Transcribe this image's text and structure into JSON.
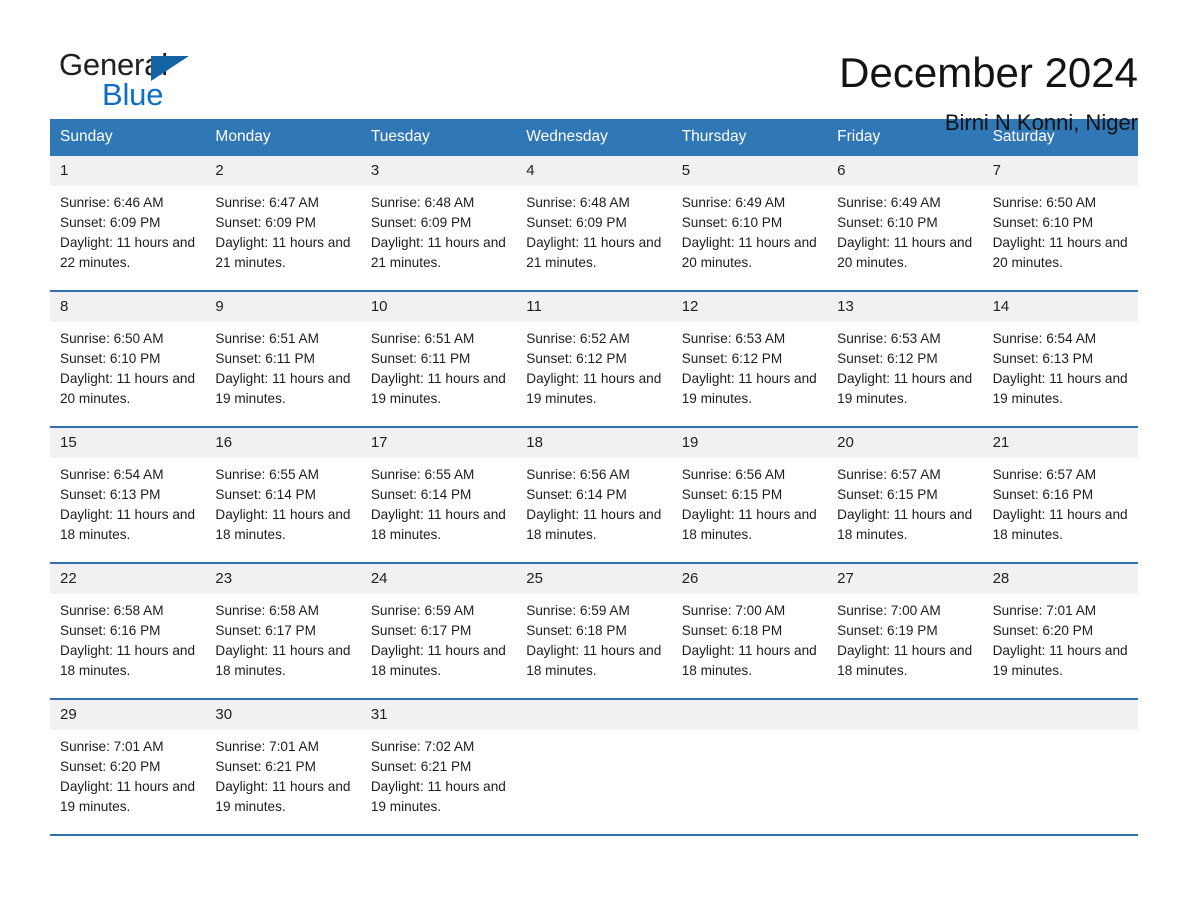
{
  "brand": {
    "name_part1": "General",
    "name_part2": "Blue"
  },
  "header": {
    "month_title": "December 2024",
    "location": "Birni N Konni, Niger"
  },
  "colors": {
    "header_blue": "#3077b5",
    "row_divider_blue": "#2e6fae",
    "date_band_gray": "#f1f1f1",
    "brand_blue": "#0d6fc4"
  },
  "calendar": {
    "weekdays": [
      "Sunday",
      "Monday",
      "Tuesday",
      "Wednesday",
      "Thursday",
      "Friday",
      "Saturday"
    ],
    "weeks": [
      {
        "days": [
          {
            "date": "1",
            "sunrise": "Sunrise: 6:46 AM",
            "sunset": "Sunset: 6:09 PM",
            "daylight": "Daylight: 11 hours and 22 minutes."
          },
          {
            "date": "2",
            "sunrise": "Sunrise: 6:47 AM",
            "sunset": "Sunset: 6:09 PM",
            "daylight": "Daylight: 11 hours and 21 minutes."
          },
          {
            "date": "3",
            "sunrise": "Sunrise: 6:48 AM",
            "sunset": "Sunset: 6:09 PM",
            "daylight": "Daylight: 11 hours and 21 minutes."
          },
          {
            "date": "4",
            "sunrise": "Sunrise: 6:48 AM",
            "sunset": "Sunset: 6:09 PM",
            "daylight": "Daylight: 11 hours and 21 minutes."
          },
          {
            "date": "5",
            "sunrise": "Sunrise: 6:49 AM",
            "sunset": "Sunset: 6:10 PM",
            "daylight": "Daylight: 11 hours and 20 minutes."
          },
          {
            "date": "6",
            "sunrise": "Sunrise: 6:49 AM",
            "sunset": "Sunset: 6:10 PM",
            "daylight": "Daylight: 11 hours and 20 minutes."
          },
          {
            "date": "7",
            "sunrise": "Sunrise: 6:50 AM",
            "sunset": "Sunset: 6:10 PM",
            "daylight": "Daylight: 11 hours and 20 minutes."
          }
        ]
      },
      {
        "days": [
          {
            "date": "8",
            "sunrise": "Sunrise: 6:50 AM",
            "sunset": "Sunset: 6:10 PM",
            "daylight": "Daylight: 11 hours and 20 minutes."
          },
          {
            "date": "9",
            "sunrise": "Sunrise: 6:51 AM",
            "sunset": "Sunset: 6:11 PM",
            "daylight": "Daylight: 11 hours and 19 minutes."
          },
          {
            "date": "10",
            "sunrise": "Sunrise: 6:51 AM",
            "sunset": "Sunset: 6:11 PM",
            "daylight": "Daylight: 11 hours and 19 minutes."
          },
          {
            "date": "11",
            "sunrise": "Sunrise: 6:52 AM",
            "sunset": "Sunset: 6:12 PM",
            "daylight": "Daylight: 11 hours and 19 minutes."
          },
          {
            "date": "12",
            "sunrise": "Sunrise: 6:53 AM",
            "sunset": "Sunset: 6:12 PM",
            "daylight": "Daylight: 11 hours and 19 minutes."
          },
          {
            "date": "13",
            "sunrise": "Sunrise: 6:53 AM",
            "sunset": "Sunset: 6:12 PM",
            "daylight": "Daylight: 11 hours and 19 minutes."
          },
          {
            "date": "14",
            "sunrise": "Sunrise: 6:54 AM",
            "sunset": "Sunset: 6:13 PM",
            "daylight": "Daylight: 11 hours and 19 minutes."
          }
        ]
      },
      {
        "days": [
          {
            "date": "15",
            "sunrise": "Sunrise: 6:54 AM",
            "sunset": "Sunset: 6:13 PM",
            "daylight": "Daylight: 11 hours and 18 minutes."
          },
          {
            "date": "16",
            "sunrise": "Sunrise: 6:55 AM",
            "sunset": "Sunset: 6:14 PM",
            "daylight": "Daylight: 11 hours and 18 minutes."
          },
          {
            "date": "17",
            "sunrise": "Sunrise: 6:55 AM",
            "sunset": "Sunset: 6:14 PM",
            "daylight": "Daylight: 11 hours and 18 minutes."
          },
          {
            "date": "18",
            "sunrise": "Sunrise: 6:56 AM",
            "sunset": "Sunset: 6:14 PM",
            "daylight": "Daylight: 11 hours and 18 minutes."
          },
          {
            "date": "19",
            "sunrise": "Sunrise: 6:56 AM",
            "sunset": "Sunset: 6:15 PM",
            "daylight": "Daylight: 11 hours and 18 minutes."
          },
          {
            "date": "20",
            "sunrise": "Sunrise: 6:57 AM",
            "sunset": "Sunset: 6:15 PM",
            "daylight": "Daylight: 11 hours and 18 minutes."
          },
          {
            "date": "21",
            "sunrise": "Sunrise: 6:57 AM",
            "sunset": "Sunset: 6:16 PM",
            "daylight": "Daylight: 11 hours and 18 minutes."
          }
        ]
      },
      {
        "days": [
          {
            "date": "22",
            "sunrise": "Sunrise: 6:58 AM",
            "sunset": "Sunset: 6:16 PM",
            "daylight": "Daylight: 11 hours and 18 minutes."
          },
          {
            "date": "23",
            "sunrise": "Sunrise: 6:58 AM",
            "sunset": "Sunset: 6:17 PM",
            "daylight": "Daylight: 11 hours and 18 minutes."
          },
          {
            "date": "24",
            "sunrise": "Sunrise: 6:59 AM",
            "sunset": "Sunset: 6:17 PM",
            "daylight": "Daylight: 11 hours and 18 minutes."
          },
          {
            "date": "25",
            "sunrise": "Sunrise: 6:59 AM",
            "sunset": "Sunset: 6:18 PM",
            "daylight": "Daylight: 11 hours and 18 minutes."
          },
          {
            "date": "26",
            "sunrise": "Sunrise: 7:00 AM",
            "sunset": "Sunset: 6:18 PM",
            "daylight": "Daylight: 11 hours and 18 minutes."
          },
          {
            "date": "27",
            "sunrise": "Sunrise: 7:00 AM",
            "sunset": "Sunset: 6:19 PM",
            "daylight": "Daylight: 11 hours and 18 minutes."
          },
          {
            "date": "28",
            "sunrise": "Sunrise: 7:01 AM",
            "sunset": "Sunset: 6:20 PM",
            "daylight": "Daylight: 11 hours and 19 minutes."
          }
        ]
      },
      {
        "days": [
          {
            "date": "29",
            "sunrise": "Sunrise: 7:01 AM",
            "sunset": "Sunset: 6:20 PM",
            "daylight": "Daylight: 11 hours and 19 minutes."
          },
          {
            "date": "30",
            "sunrise": "Sunrise: 7:01 AM",
            "sunset": "Sunset: 6:21 PM",
            "daylight": "Daylight: 11 hours and 19 minutes."
          },
          {
            "date": "31",
            "sunrise": "Sunrise: 7:02 AM",
            "sunset": "Sunset: 6:21 PM",
            "daylight": "Daylight: 11 hours and 19 minutes."
          },
          {
            "date": "",
            "sunrise": "",
            "sunset": "",
            "daylight": ""
          },
          {
            "date": "",
            "sunrise": "",
            "sunset": "",
            "daylight": ""
          },
          {
            "date": "",
            "sunrise": "",
            "sunset": "",
            "daylight": ""
          },
          {
            "date": "",
            "sunrise": "",
            "sunset": "",
            "daylight": ""
          }
        ]
      }
    ]
  }
}
